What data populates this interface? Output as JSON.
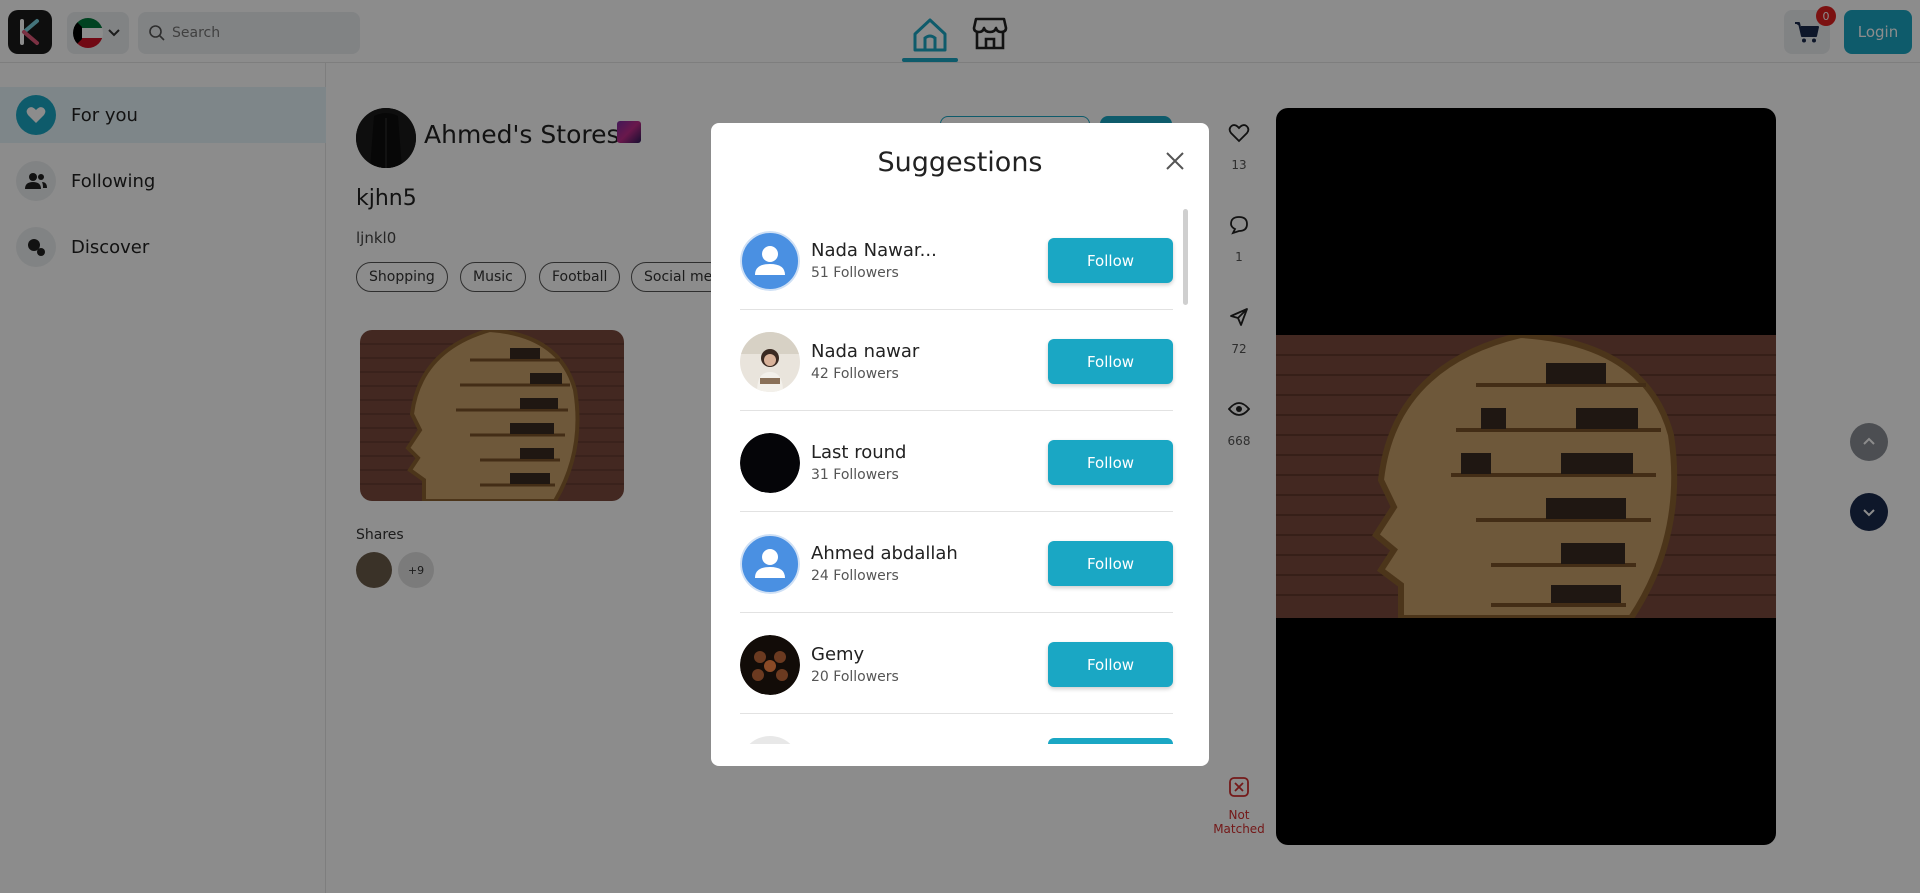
{
  "header": {
    "search_placeholder": "Search",
    "cart_count": "0",
    "login_label": "Login"
  },
  "sidebar": {
    "items": [
      {
        "label": "For you",
        "icon": "heart-icon",
        "active": true
      },
      {
        "label": "Following",
        "icon": "users-icon",
        "active": false
      },
      {
        "label": "Discover",
        "icon": "discover-icon",
        "active": false
      }
    ]
  },
  "post": {
    "store_name": "Ahmed's Stores",
    "title": "kjhn5",
    "description": "ljnkl0",
    "tags": [
      "Shopping",
      "Music",
      "Football",
      "Social me"
    ],
    "shares_label": "Shares",
    "shares_more": "+9"
  },
  "actions": {
    "likes": "13",
    "comments": "1",
    "shares": "72",
    "views": "668",
    "not_matched": "Not Matched"
  },
  "modal": {
    "title": "Suggestions",
    "follow_label": "Follow",
    "users": [
      {
        "name": "Nada Nawar...",
        "followers": "51 Followers",
        "avatar": "default"
      },
      {
        "name": "Nada nawar",
        "followers": "42 Followers",
        "avatar": "photo"
      },
      {
        "name": "Last round",
        "followers": "31 Followers",
        "avatar": "black"
      },
      {
        "name": "Ahmed abdallah",
        "followers": "24 Followers",
        "avatar": "default"
      },
      {
        "name": "Gemy",
        "followers": "20 Followers",
        "avatar": "group"
      }
    ]
  },
  "colors": {
    "accent": "#1aa7c4",
    "danger": "#d32f2f",
    "navy": "#1b2a4e"
  }
}
